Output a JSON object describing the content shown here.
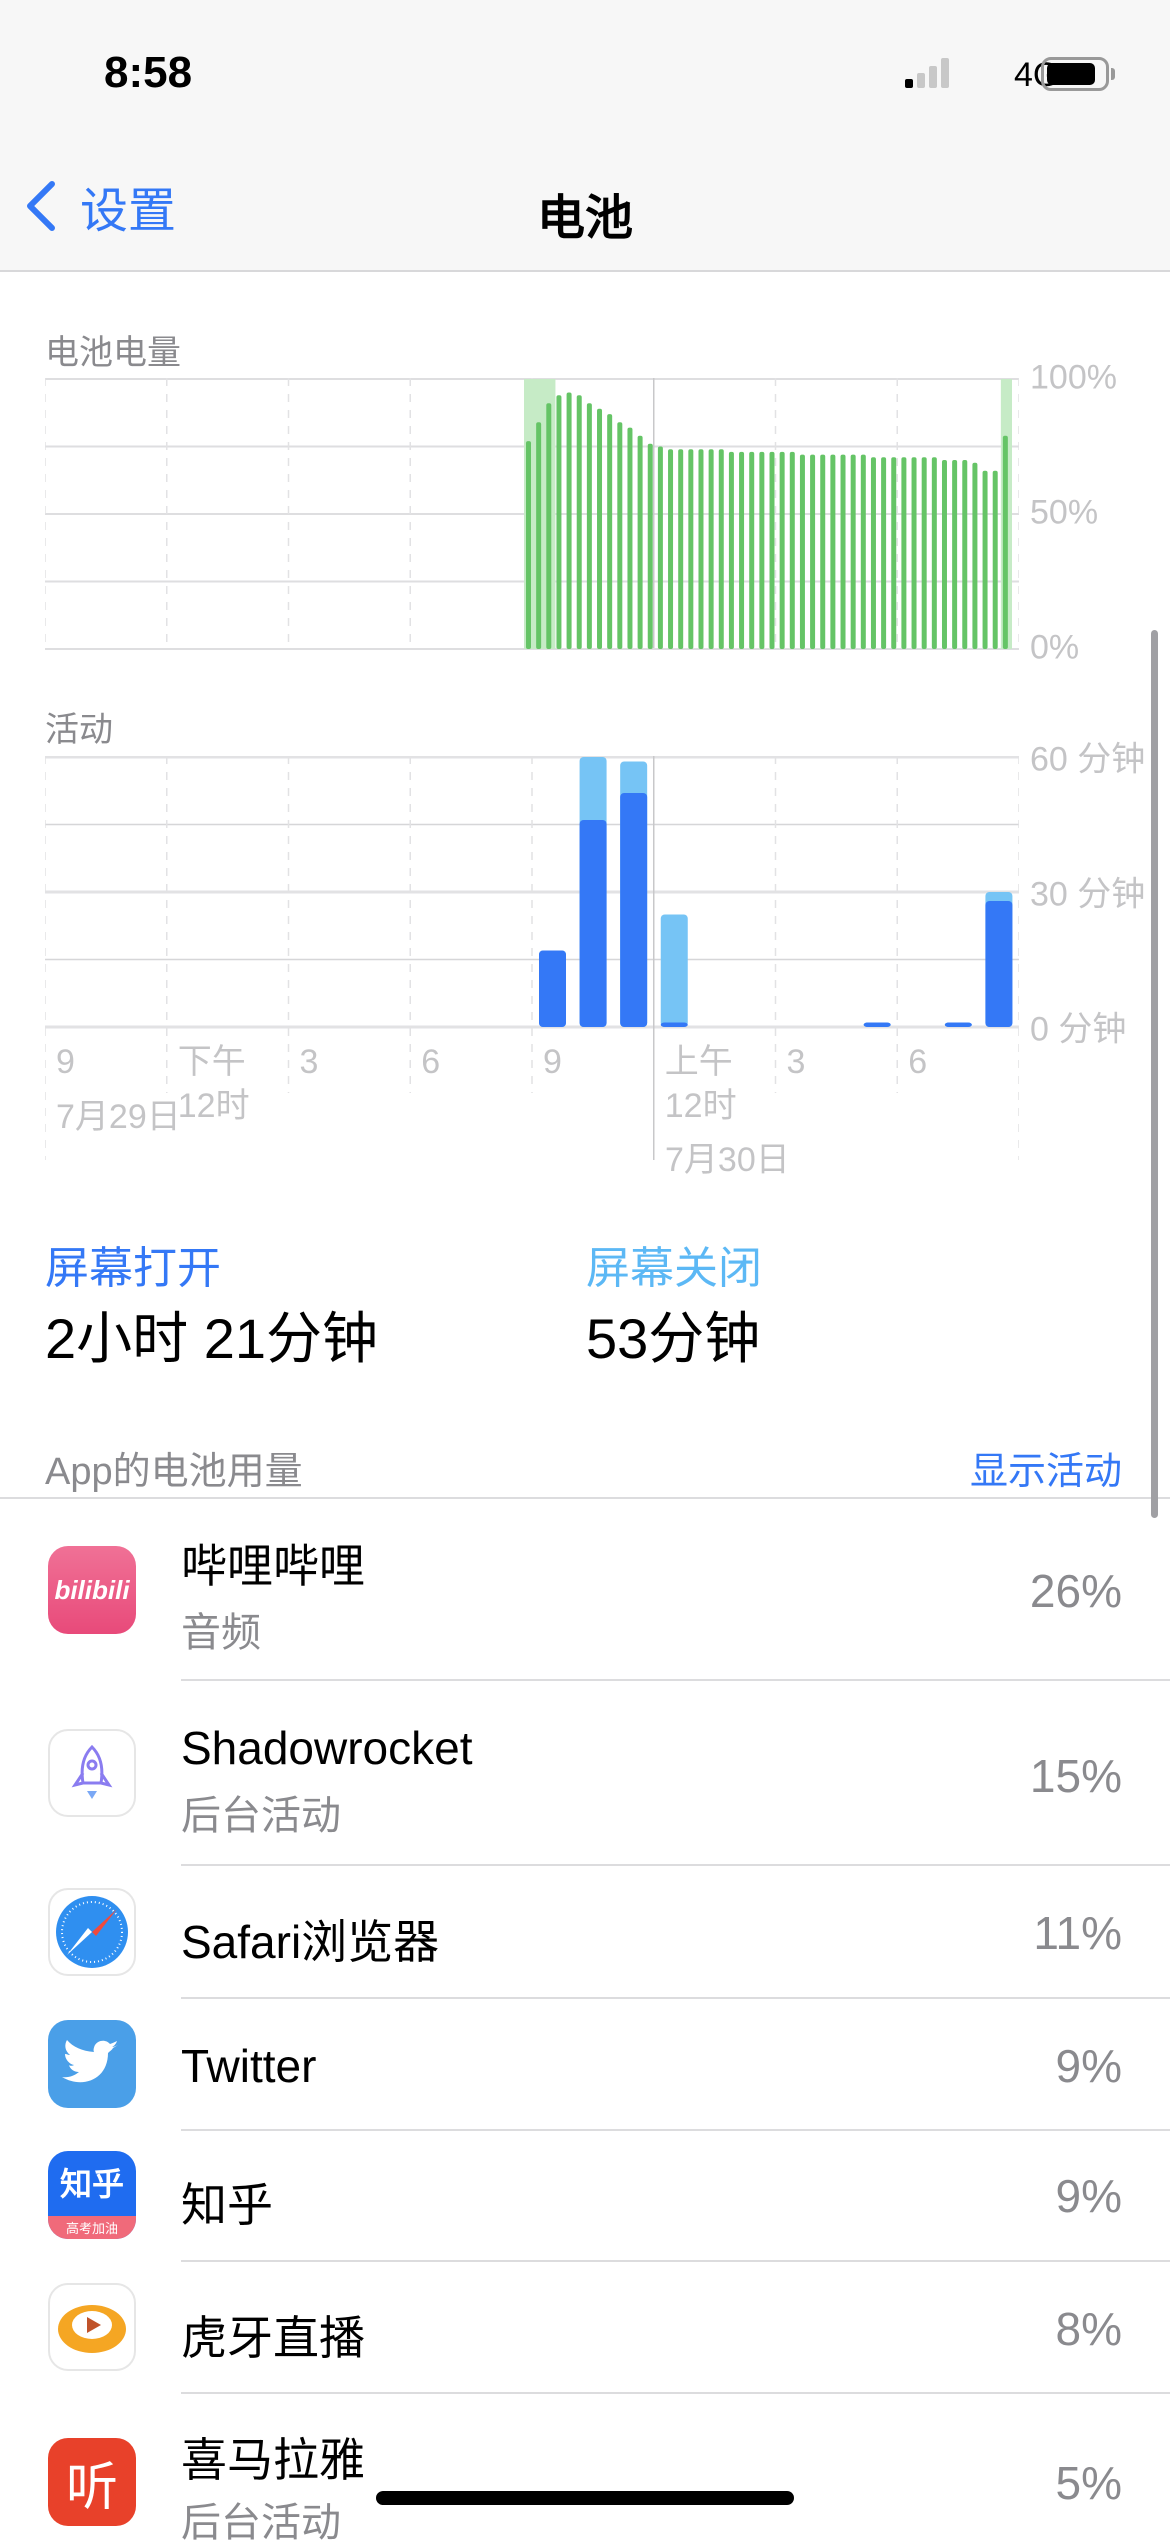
{
  "status_bar": {
    "time": "8:58",
    "network": "4G",
    "signal_bars": 1,
    "battery_level": 0.85
  },
  "nav": {
    "back_label": "设置",
    "title": "电池"
  },
  "battery_section": {
    "label": "电池电量",
    "y_labels": [
      "100%",
      "50%",
      "0%"
    ]
  },
  "activity_section": {
    "label": "活动",
    "y_labels": [
      "60 分钟",
      "30 分钟",
      "0 分钟"
    ],
    "x_labels": [
      {
        "top": "9",
        "bottom": ""
      },
      {
        "top": "下午",
        "bottom": "12时"
      },
      {
        "top": "3",
        "bottom": ""
      },
      {
        "top": "6",
        "bottom": ""
      },
      {
        "top": "9",
        "bottom": ""
      },
      {
        "top": "上午",
        "bottom": "12时"
      },
      {
        "top": "3",
        "bottom": ""
      },
      {
        "top": "6",
        "bottom": ""
      }
    ],
    "dates": [
      "7月29日",
      "7月30日"
    ]
  },
  "summary": {
    "screen_on_label": "屏幕打开",
    "screen_on_value": "2小时 21分钟",
    "screen_off_label": "屏幕关闭",
    "screen_off_value": "53分钟"
  },
  "usage": {
    "header": "App的电池用量",
    "show_activity": "显示活动",
    "apps": [
      {
        "name": "哔哩哔哩",
        "sub": "音频",
        "pct": "26%",
        "icon": "bilibili-icon"
      },
      {
        "name": "Shadowrocket",
        "sub": "后台活动",
        "pct": "15%",
        "icon": "shadowrocket-icon"
      },
      {
        "name": "Safari浏览器",
        "sub": "",
        "pct": "11%",
        "icon": "safari-icon"
      },
      {
        "name": "Twitter",
        "sub": "",
        "pct": "9%",
        "icon": "twitter-icon"
      },
      {
        "name": "知乎",
        "sub": "",
        "pct": "9%",
        "icon": "zhihu-icon"
      },
      {
        "name": "虎牙直播",
        "sub": "",
        "pct": "8%",
        "icon": "huya-icon"
      },
      {
        "name": "喜马拉雅",
        "sub": "后台活动",
        "pct": "5%",
        "icon": "ximalaya-icon"
      }
    ],
    "icon_text": {
      "bilibili": "bilibili",
      "zhihu": "知乎",
      "zhihu_banner": "高考加油",
      "ximalaya": "听"
    }
  },
  "colors": {
    "accent": "#3478f6",
    "battery": "#65c466",
    "charging": "#c6ebc6",
    "screen_on": "#3478f6",
    "screen_off": "#76c4f5"
  },
  "chart_data": [
    {
      "type": "bar",
      "title": "电池电量",
      "ylabel": "%",
      "ylim": [
        0,
        100
      ],
      "interval_minutes": 15,
      "x_range": "7月29日 9:00 – 7月30日 9:00",
      "start_slot": 48,
      "values": [
        77,
        84,
        91,
        94,
        95,
        94,
        91,
        89,
        87,
        84,
        82,
        79,
        76,
        75,
        74,
        74,
        74,
        74,
        74,
        74,
        73,
        73,
        73,
        73,
        73,
        73,
        73,
        72,
        72,
        72,
        72,
        72,
        72,
        72,
        71,
        71,
        71,
        71,
        71,
        71,
        71,
        70,
        70,
        70,
        69,
        66,
        66,
        79
      ],
      "charging_slots": [
        0,
        1,
        2,
        47
      ]
    },
    {
      "type": "bar",
      "title": "活动",
      "ylabel": "分钟",
      "ylim": [
        0,
        60
      ],
      "categories_hours": [
        9,
        10,
        11,
        12,
        13,
        14,
        15,
        16,
        17,
        18,
        19,
        20,
        21,
        22,
        23,
        0,
        1,
        2,
        3,
        4,
        5,
        6,
        7,
        8
      ],
      "series": [
        {
          "name": "屏幕打开",
          "values": [
            0,
            0,
            0,
            0,
            0,
            0,
            0,
            0,
            0,
            0,
            0,
            0,
            17,
            46,
            52,
            1,
            0,
            0,
            0,
            0,
            1,
            0,
            1,
            28
          ]
        },
        {
          "name": "屏幕关闭",
          "values": [
            0,
            0,
            0,
            0,
            0,
            0,
            0,
            0,
            0,
            0,
            0,
            0,
            0,
            14,
            7,
            24,
            0,
            0,
            0,
            0,
            0,
            0,
            0,
            2
          ]
        }
      ]
    }
  ]
}
